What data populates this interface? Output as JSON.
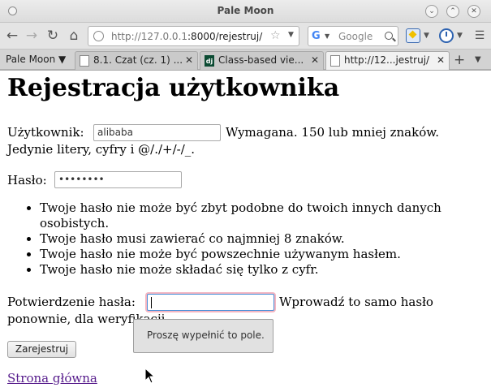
{
  "window": {
    "title": "Pale Moon"
  },
  "toolbar": {
    "url_host": "http://127.0.0.1",
    "url_path": ":8000/rejestruj/",
    "search_engine": "G",
    "search_placeholder": "Google",
    "brand_color": "#4285f4"
  },
  "tabs": {
    "menu_label": "Pale Moon ▼",
    "items": [
      {
        "label": "8.1. Czat (cz. 1) ..."
      },
      {
        "label": "Class-based vie..."
      },
      {
        "label": "http://12...jestruj/"
      }
    ]
  },
  "page": {
    "heading": "Rejestracja użytkownika",
    "username_label": "Użytkownik:",
    "username_value": "alibaba",
    "username_help_1": "Wymagana. 150 lub mniej znaków.",
    "username_help_2": "Jedynie litery, cyfry i @/./+/-/_.",
    "password_label": "Hasło:",
    "password_value": "••••••••",
    "password_rules": [
      "Twoje hasło nie może być zbyt podobne do twoich innych danych",
      "osobistych.",
      "Twoje hasło musi zawierać co najmniej 8 znaków.",
      "Twoje hasło nie może być powszechnie używanym hasłem.",
      "Twoje hasło nie może składać się tylko z cyfr."
    ],
    "confirm_label": "Potwierdzenie hasła:",
    "confirm_help_1": "Wprowadź to samo hasło",
    "confirm_help_2_visible": "ponownie, dla weryf",
    "confirm_help_2_tail": "ikacji.",
    "validation_tooltip": "Proszę wypełnić to pole.",
    "submit_label": "Zarejestruj",
    "home_link": "Strona główna",
    "link_color": "#551a8b",
    "focus_ring_color": "#f4b6c2"
  }
}
